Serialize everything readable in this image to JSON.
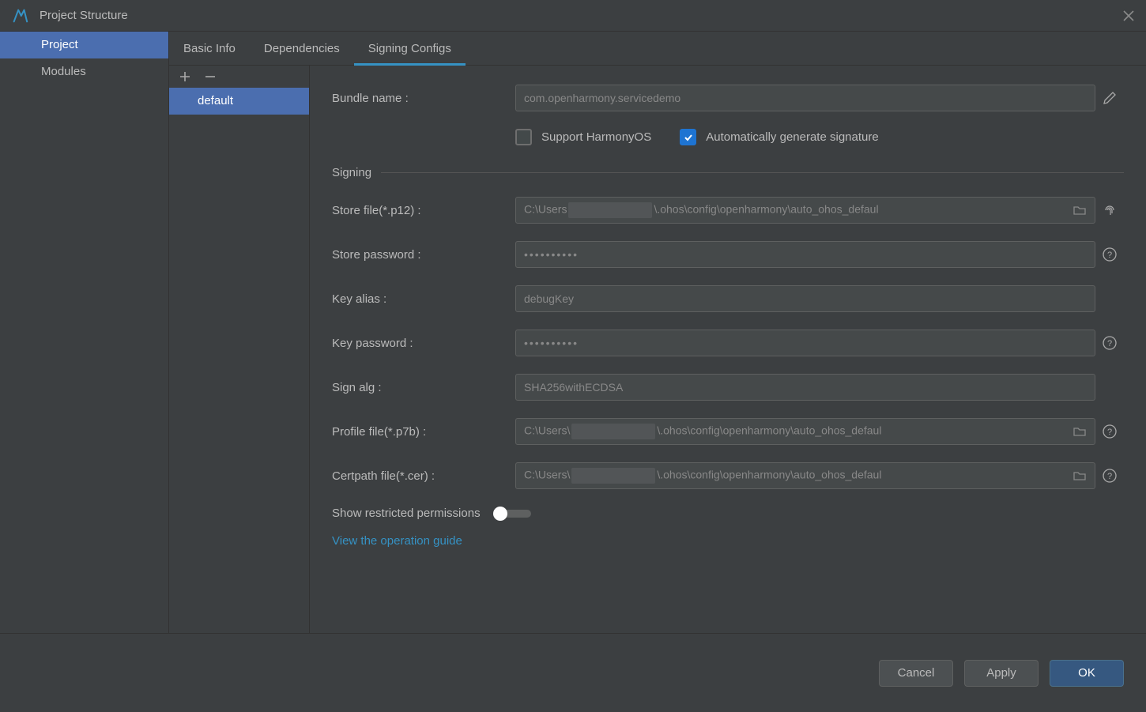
{
  "title": "Project Structure",
  "sidebar": {
    "items": [
      {
        "label": "Project"
      },
      {
        "label": "Modules"
      }
    ]
  },
  "tabs": [
    {
      "label": "Basic Info"
    },
    {
      "label": "Dependencies"
    },
    {
      "label": "Signing Configs"
    }
  ],
  "configs": {
    "items": [
      {
        "label": "default"
      }
    ]
  },
  "form": {
    "bundle_name_label": "Bundle name :",
    "bundle_name": "com.openharmony.servicedemo",
    "support_harmony_label": "Support HarmonyOS",
    "auto_generate_label": "Automatically generate signature",
    "signing_section": "Signing",
    "store_file_label": "Store file(*.p12) :",
    "store_file_pre": "C:\\Users",
    "store_file_post": "\\.ohos\\config\\openharmony\\auto_ohos_defaul",
    "store_password_label": "Store password :",
    "store_password": "••••••••••",
    "key_alias_label": "Key alias :",
    "key_alias": "debugKey",
    "key_password_label": "Key password :",
    "key_password": "••••••••••",
    "sign_alg_label": "Sign alg :",
    "sign_alg": "SHA256withECDSA",
    "profile_file_label": "Profile file(*.p7b) :",
    "profile_file_pre": "C:\\Users\\",
    "profile_file_post": "\\.ohos\\config\\openharmony\\auto_ohos_defaul",
    "certpath_file_label": "Certpath file(*.cer) :",
    "certpath_file_pre": "C:\\Users\\",
    "certpath_file_post": "\\.ohos\\config\\openharmony\\auto_ohos_defaul",
    "show_restricted_label": "Show restricted permissions",
    "guide_link": "View the operation guide"
  },
  "footer": {
    "cancel": "Cancel",
    "apply": "Apply",
    "ok": "OK"
  }
}
